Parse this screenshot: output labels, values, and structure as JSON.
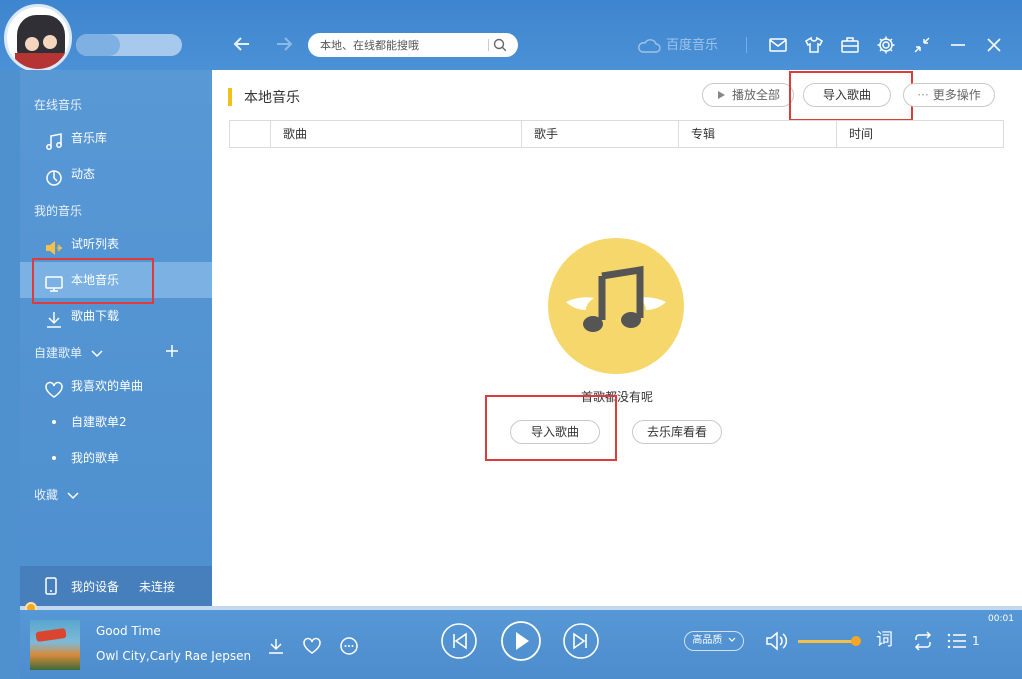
{
  "search": {
    "placeholder": "本地、在线都能搜哦"
  },
  "brand": {
    "name": "百度音乐"
  },
  "sidebar": {
    "online_section": "在线音乐",
    "online_items": [
      {
        "label": "音乐库",
        "icon": "music-note-icon"
      },
      {
        "label": "动态",
        "icon": "dynamic-icon"
      }
    ],
    "my_section": "我的音乐",
    "my_items": [
      {
        "label": "试听列表",
        "icon": "speaker-icon"
      },
      {
        "label": "本地音乐",
        "icon": "monitor-icon"
      },
      {
        "label": "歌曲下载",
        "icon": "download-icon"
      }
    ],
    "custom_section": "自建歌单",
    "playlists": [
      {
        "label": "我喜欢的单曲",
        "icon": "heart-icon"
      },
      {
        "label": "自建歌单2"
      },
      {
        "label": "我的歌单"
      }
    ],
    "favorites_section": "收藏",
    "device": {
      "label": "我的设备",
      "status": "未连接"
    }
  },
  "main": {
    "title": "本地音乐",
    "actions": {
      "play_all": "播放全部",
      "import": "导入歌曲",
      "more": "更多操作"
    },
    "columns": [
      "歌曲",
      "歌手",
      "专辑",
      "时间"
    ],
    "empty": {
      "message": "首歌都没有呢",
      "import": "导入歌曲",
      "browse": "去乐库看看"
    }
  },
  "player": {
    "title": "Good Time",
    "artist": "Owl City,Carly Rae Jepsen",
    "quality": "高品质",
    "lyrics": "词",
    "time": "00:01",
    "playlist_count": "1",
    "volume": 0.9,
    "progress": 0.0
  },
  "colors": {
    "accent": "#f2c21c",
    "highlight": "#e03b3b",
    "primary": "#4a91d6"
  }
}
